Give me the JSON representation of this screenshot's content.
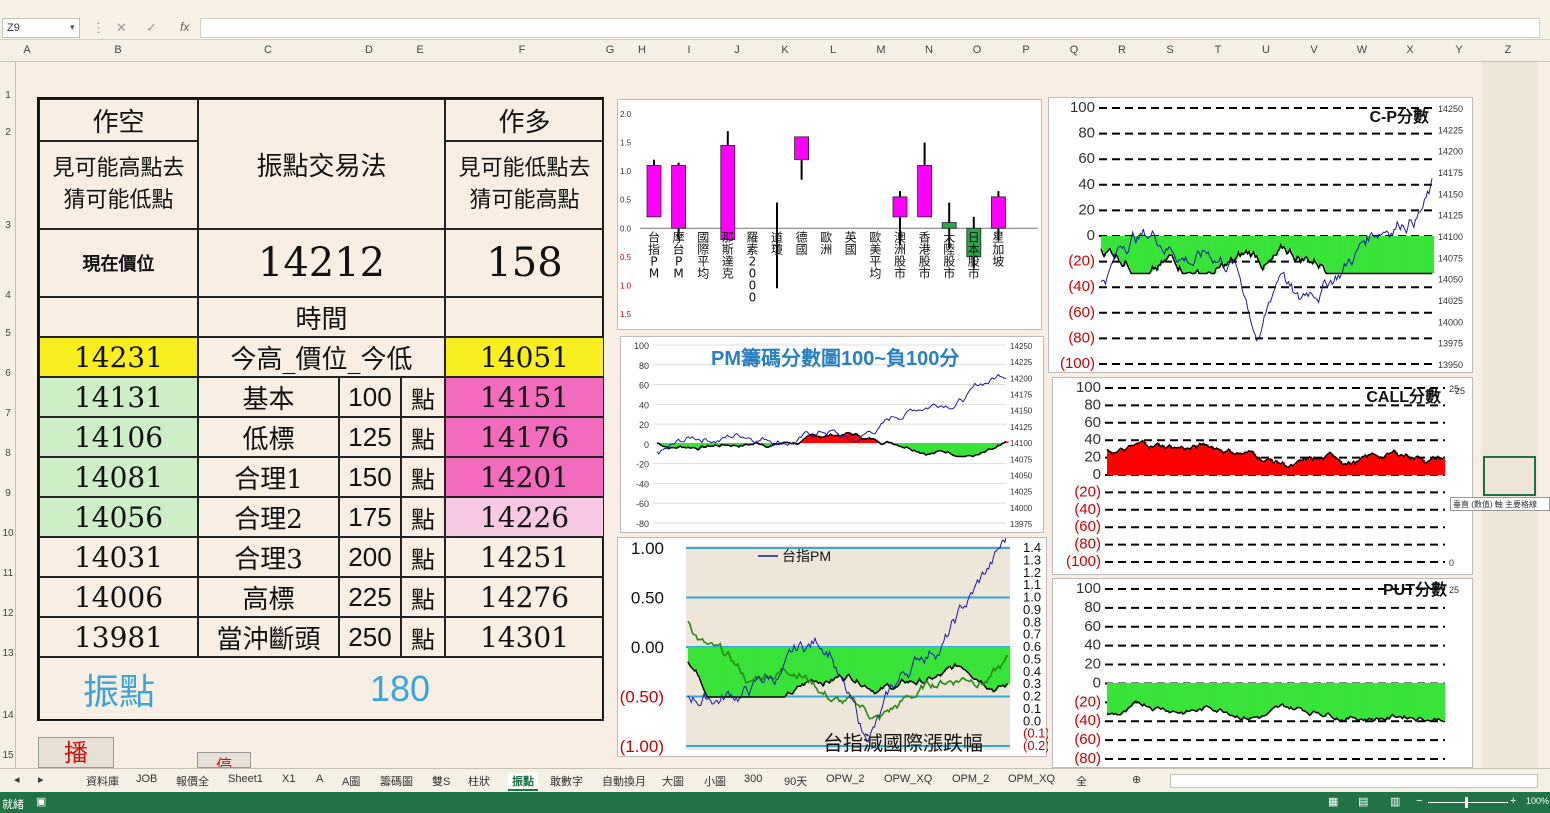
{
  "namebox": "Z9",
  "formula_icons": [
    "cancel",
    "confirm",
    "fx"
  ],
  "columns": [
    "A",
    "B",
    "C",
    "D",
    "E",
    "F",
    "G",
    "H",
    "I",
    "J",
    "K",
    "L",
    "M",
    "N",
    "O",
    "P",
    "Q",
    "R",
    "S",
    "T",
    "U",
    "V",
    "W",
    "X",
    "Y",
    "Z"
  ],
  "rows": [
    "1",
    "2",
    "3",
    "4",
    "5",
    "6",
    "7",
    "8",
    "9",
    "10",
    "11",
    "12",
    "13",
    "14",
    "15"
  ],
  "table": {
    "short_title": "作空",
    "short_desc": "見可能高點去猜可能低點",
    "method": "振點交易法",
    "long_title": "作多",
    "long_desc": "見可能低點去猜可能高點",
    "price_label": "現在價位",
    "price": "14212",
    "right_value": "158",
    "time_label": "時間",
    "hl_row": {
      "left": "14231",
      "mid": "今高_價位_今低",
      "right": "14051"
    },
    "levels": [
      {
        "left": "14131",
        "name": "基本",
        "pts": "100",
        "unit": "點",
        "right": "14151"
      },
      {
        "left": "14106",
        "name": "低標",
        "pts": "125",
        "unit": "點",
        "right": "14176"
      },
      {
        "left": "14081",
        "name": "合理1",
        "pts": "150",
        "unit": "點",
        "right": "14201"
      },
      {
        "left": "14056",
        "name": "合理2",
        "pts": "175",
        "unit": "點",
        "right": "14226"
      },
      {
        "left": "14031",
        "name": "合理3",
        "pts": "200",
        "unit": "點",
        "right": "14251"
      },
      {
        "left": "14006",
        "name": "高標",
        "pts": "225",
        "unit": "點",
        "right": "14276"
      },
      {
        "left": "13981",
        "name": "當沖斷頭",
        "pts": "250",
        "unit": "點",
        "right": "14301"
      }
    ],
    "swing_label": "振點",
    "swing_value": "180"
  },
  "buttons": {
    "play": "播",
    "stop": "停"
  },
  "chart_data": [
    {
      "type": "candlestick",
      "title": "",
      "categories": [
        "台指PM",
        "摩台PM",
        "國際平均",
        "那斯達克",
        "羅素2000",
        "道瓊",
        "德國",
        "歐洲",
        "英國",
        "歐美平均",
        "澳洲股市",
        "香港股市",
        "大陸股市",
        "日本股市",
        "星加坡"
      ],
      "y_ticks": [
        "2.0",
        "1.5",
        "1.0",
        "0.5",
        "0.0",
        "0.5",
        "1.0",
        "1.5"
      ],
      "ylim": [
        -1.5,
        2.0
      ],
      "candles": [
        {
          "o": 0.2,
          "c": 1.1,
          "h": 1.2,
          "l": 0.2,
          "color": "#ff00ff"
        },
        {
          "o": 0.0,
          "c": 1.1,
          "h": 1.15,
          "l": -0.2,
          "color": "#ff00ff"
        },
        {
          "o": 0,
          "c": 0,
          "h": 0,
          "l": 0,
          "color": "#000"
        },
        {
          "o": -0.2,
          "c": 1.45,
          "h": 1.7,
          "l": -0.2,
          "color": "#ff00ff"
        },
        {
          "o": 0,
          "c": 0,
          "h": 0,
          "l": 0,
          "color": "#000"
        },
        {
          "o": 0,
          "c": 0,
          "h": 0.45,
          "l": -1.05,
          "color": "#000"
        },
        {
          "o": 1.2,
          "c": 1.6,
          "h": 1.6,
          "l": 0.85,
          "color": "#ff00ff"
        },
        {
          "o": 0,
          "c": 0,
          "h": 0,
          "l": 0,
          "color": "#000"
        },
        {
          "o": 0,
          "c": 0,
          "h": 0,
          "l": 0,
          "color": "#000"
        },
        {
          "o": 0,
          "c": 0,
          "h": 0,
          "l": 0,
          "color": "#000"
        },
        {
          "o": 0.2,
          "c": 0.55,
          "h": 0.65,
          "l": -0.3,
          "color": "#ff00ff"
        },
        {
          "o": 0.2,
          "c": 1.1,
          "h": 1.5,
          "l": 0.2,
          "color": "#ff00ff"
        },
        {
          "o": 0.0,
          "c": 0.1,
          "h": 0.45,
          "l": -0.35,
          "color": "#2aa84a"
        },
        {
          "o": 0.0,
          "c": -0.5,
          "h": 0.2,
          "l": -0.7,
          "color": "#2aa84a"
        },
        {
          "o": 0.0,
          "c": 0.55,
          "h": 0.65,
          "l": -0.2,
          "color": "#ff00ff"
        }
      ]
    },
    {
      "type": "area",
      "title": "PM籌碼分數圖100~負100分",
      "yticks": [
        "100",
        "80",
        "60",
        "40",
        "20",
        "0",
        "-20",
        "-40",
        "-60",
        "-80"
      ],
      "y2ticks": [
        "14250",
        "14225",
        "14200",
        "14175",
        "14150",
        "14125",
        "14100",
        "14075",
        "14050",
        "14025",
        "14000",
        "13975"
      ]
    },
    {
      "type": "area",
      "title": "台指減國際漲跌幅",
      "legend": "台指PM",
      "yticks": [
        "1.00",
        "0.50",
        "0.00",
        "(0.50)",
        "(1.00)"
      ],
      "y2ticks": [
        "1.4",
        "1.3",
        "1.2",
        "1.1",
        "1.0",
        "0.9",
        "0.8",
        "0.7",
        "0.6",
        "0.5",
        "0.4",
        "0.3",
        "0.2",
        "0.1",
        "0.0",
        "(0.1)",
        "(0.2)"
      ]
    },
    {
      "type": "area",
      "title": "C-P分數",
      "yticks": [
        "100",
        "80",
        "60",
        "40",
        "20",
        "0",
        "(20)",
        "(40)",
        "(60)",
        "(80)",
        "(100)"
      ],
      "y2ticks": [
        "14250",
        "14225",
        "14200",
        "14175",
        "14150",
        "14125",
        "14100",
        "14075",
        "14050",
        "14025",
        "14000",
        "13975",
        "13950"
      ]
    },
    {
      "type": "area",
      "title": "CALL分數",
      "yticks": [
        "100",
        "80",
        "60",
        "40",
        "20",
        "0",
        "(20)",
        "(40)",
        "(60)",
        "(80)",
        "(100)"
      ],
      "y2ticks": [
        "25",
        "0"
      ]
    },
    {
      "type": "area",
      "title": "PUT分數",
      "yticks": [
        "100",
        "80",
        "60",
        "40",
        "20",
        "0",
        "(20)",
        "(40)",
        "(60)",
        "(80)"
      ],
      "y2ticks": [
        "25"
      ]
    }
  ],
  "tooltip": "垂直 (數值) 軸 主要格線",
  "sheet_tabs": [
    "資料庫",
    "JOB",
    "報價全",
    "Sheet1",
    "X1",
    "A",
    "A圖",
    "籌碼圖",
    "雙S",
    "柱狀",
    "振點",
    "敢數字",
    "自動換月",
    "大圖",
    "小圖",
    "300",
    "90天",
    "OPW_2",
    "OPW_XQ",
    "OPM_2",
    "OPM_XQ",
    "全"
  ],
  "active_tab": "振點",
  "status": {
    "ready": "就緒",
    "zoom": "100%"
  },
  "colors": {
    "yellow": "#f9ef20",
    "green": "#cdeec6",
    "pink": "#f26bbd",
    "light_pink": "#f7c9e4",
    "accent": "#217346",
    "swing": "#3aa5d8"
  }
}
